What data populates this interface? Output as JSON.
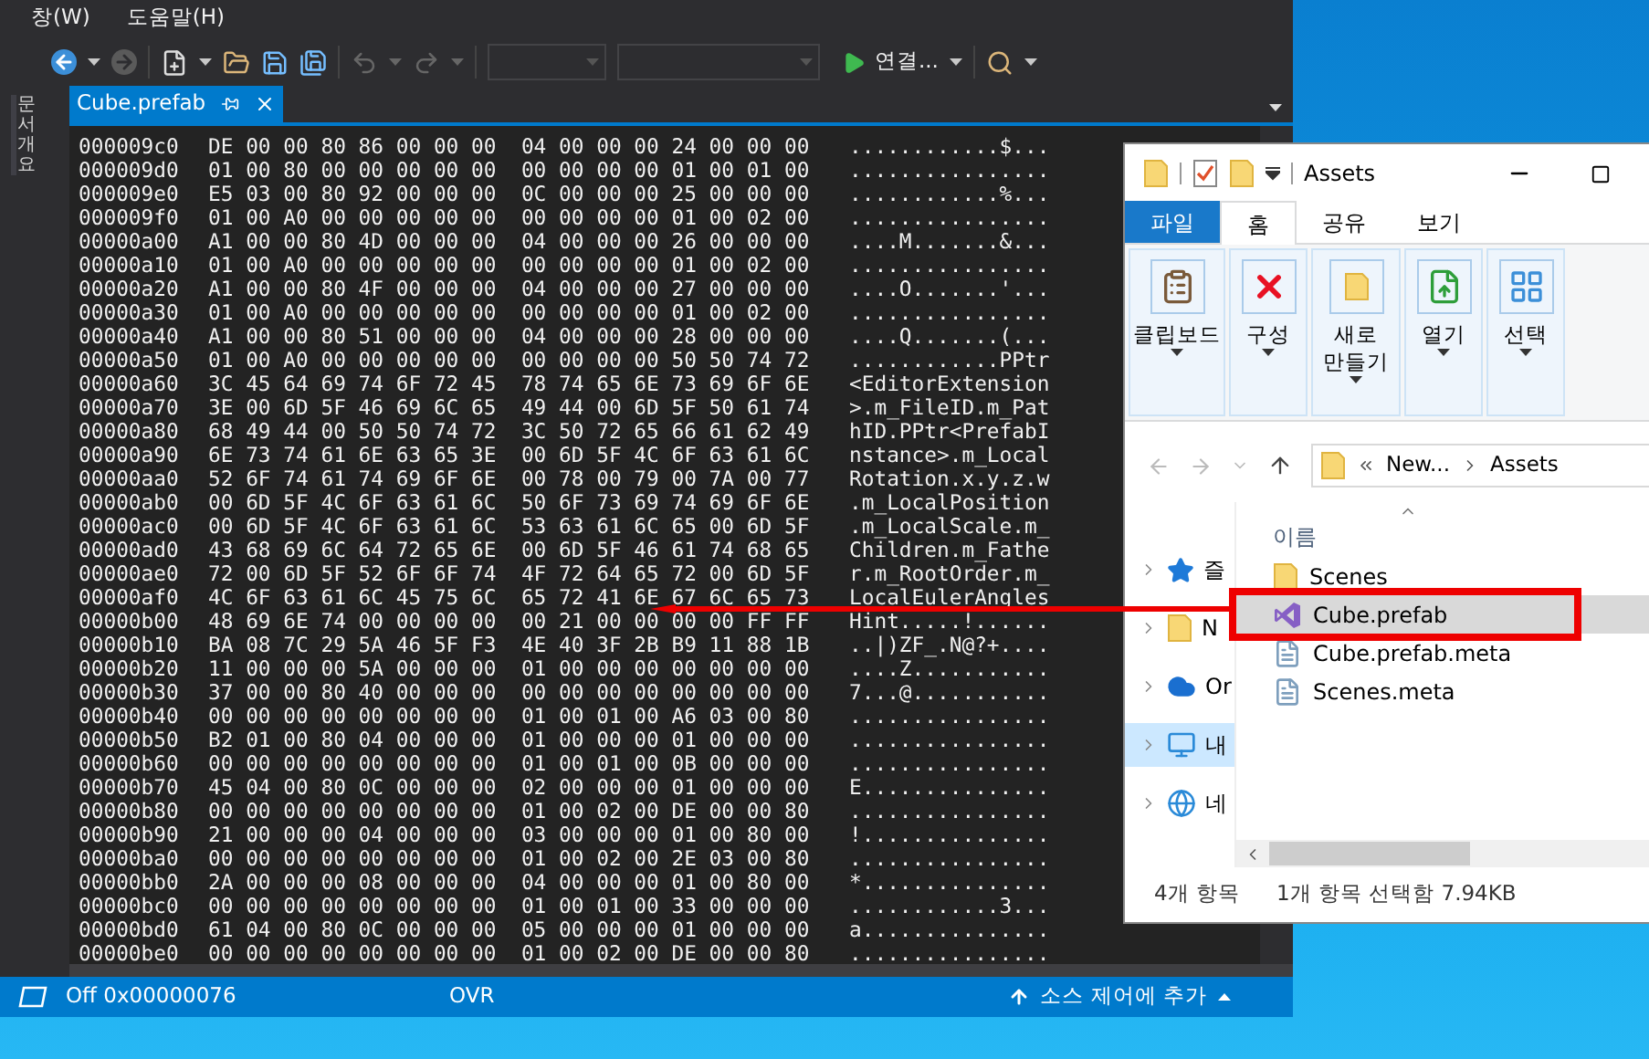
{
  "ide": {
    "menu": [
      {
        "label": "창(W)"
      },
      {
        "label": "도움말(H)"
      }
    ],
    "toolbar": {
      "run_label": "연결..."
    },
    "side_tab": "문서 개요",
    "tabs": [
      {
        "label": "Cube.prefab",
        "selected": true
      }
    ],
    "hex_rows": [
      {
        "offset": "000009c0",
        "bytes": "DE 00 00 80 86 00 00 00  04 00 00 00 24 00 00 00",
        "text": "............$..."
      },
      {
        "offset": "000009d0",
        "bytes": "01 00 80 00 00 00 00 00  00 00 00 00 01 00 01 00",
        "text": "................"
      },
      {
        "offset": "000009e0",
        "bytes": "E5 03 00 80 92 00 00 00  0C 00 00 00 25 00 00 00",
        "text": "............%..."
      },
      {
        "offset": "000009f0",
        "bytes": "01 00 A0 00 00 00 00 00  00 00 00 00 01 00 02 00",
        "text": "................"
      },
      {
        "offset": "00000a00",
        "bytes": "A1 00 00 80 4D 00 00 00  04 00 00 00 26 00 00 00",
        "text": "....M.......&..."
      },
      {
        "offset": "00000a10",
        "bytes": "01 00 A0 00 00 00 00 00  00 00 00 00 01 00 02 00",
        "text": "................"
      },
      {
        "offset": "00000a20",
        "bytes": "A1 00 00 80 4F 00 00 00  04 00 00 00 27 00 00 00",
        "text": "....O.......'..."
      },
      {
        "offset": "00000a30",
        "bytes": "01 00 A0 00 00 00 00 00  00 00 00 00 01 00 02 00",
        "text": "................"
      },
      {
        "offset": "00000a40",
        "bytes": "A1 00 00 80 51 00 00 00  04 00 00 00 28 00 00 00",
        "text": "....Q.......(..."
      },
      {
        "offset": "00000a50",
        "bytes": "01 00 A0 00 00 00 00 00  00 00 00 00 50 50 74 72",
        "text": "............PPtr"
      },
      {
        "offset": "00000a60",
        "bytes": "3C 45 64 69 74 6F 72 45  78 74 65 6E 73 69 6F 6E",
        "text": "<EditorExtension"
      },
      {
        "offset": "00000a70",
        "bytes": "3E 00 6D 5F 46 69 6C 65  49 44 00 6D 5F 50 61 74",
        "text": ">.m_FileID.m_Pat"
      },
      {
        "offset": "00000a80",
        "bytes": "68 49 44 00 50 50 74 72  3C 50 72 65 66 61 62 49",
        "text": "hID.PPtr<PrefabI"
      },
      {
        "offset": "00000a90",
        "bytes": "6E 73 74 61 6E 63 65 3E  00 6D 5F 4C 6F 63 61 6C",
        "text": "nstance>.m_Local"
      },
      {
        "offset": "00000aa0",
        "bytes": "52 6F 74 61 74 69 6F 6E  00 78 00 79 00 7A 00 77",
        "text": "Rotation.x.y.z.w"
      },
      {
        "offset": "00000ab0",
        "bytes": "00 6D 5F 4C 6F 63 61 6C  50 6F 73 69 74 69 6F 6E",
        "text": ".m_LocalPosition"
      },
      {
        "offset": "00000ac0",
        "bytes": "00 6D 5F 4C 6F 63 61 6C  53 63 61 6C 65 00 6D 5F",
        "text": ".m_LocalScale.m_"
      },
      {
        "offset": "00000ad0",
        "bytes": "43 68 69 6C 64 72 65 6E  00 6D 5F 46 61 74 68 65",
        "text": "Children.m_Fathe"
      },
      {
        "offset": "00000ae0",
        "bytes": "72 00 6D 5F 52 6F 6F 74  4F 72 64 65 72 00 6D 5F",
        "text": "r.m_RootOrder.m_"
      },
      {
        "offset": "00000af0",
        "bytes": "4C 6F 63 61 6C 45 75 6C  65 72 41 6E 67 6C 65 73",
        "text": "LocalEulerAngles"
      },
      {
        "offset": "00000b00",
        "bytes": "48 69 6E 74 00 00 00 00  00 21 00 00 00 00 FF FF",
        "text": "Hint.....!......"
      },
      {
        "offset": "00000b10",
        "bytes": "BA 08 7C 29 5A 46 5F F3  4E 40 3F 2B B9 11 88 1B",
        "text": "..|)ZF_.N@?+...."
      },
      {
        "offset": "00000b20",
        "bytes": "11 00 00 00 5A 00 00 00  01 00 00 00 00 00 00 00",
        "text": "....Z..........."
      },
      {
        "offset": "00000b30",
        "bytes": "37 00 00 80 40 00 00 00  00 00 00 00 00 00 00 00",
        "text": "7...@..........."
      },
      {
        "offset": "00000b40",
        "bytes": "00 00 00 00 00 00 00 00  01 00 01 00 A6 03 00 80",
        "text": "................"
      },
      {
        "offset": "00000b50",
        "bytes": "B2 01 00 80 04 00 00 00  01 00 00 00 01 00 00 00",
        "text": "................"
      },
      {
        "offset": "00000b60",
        "bytes": "00 00 00 00 00 00 00 00  01 00 01 00 0B 00 00 00",
        "text": "................"
      },
      {
        "offset": "00000b70",
        "bytes": "45 04 00 80 0C 00 00 00  02 00 00 00 01 00 00 00",
        "text": "E..............."
      },
      {
        "offset": "00000b80",
        "bytes": "00 00 00 00 00 00 00 00  01 00 02 00 DE 00 00 80",
        "text": "................"
      },
      {
        "offset": "00000b90",
        "bytes": "21 00 00 00 04 00 00 00  03 00 00 00 01 00 80 00",
        "text": "!..............."
      },
      {
        "offset": "00000ba0",
        "bytes": "00 00 00 00 00 00 00 00  01 00 02 00 2E 03 00 80",
        "text": "................"
      },
      {
        "offset": "00000bb0",
        "bytes": "2A 00 00 00 08 00 00 00  04 00 00 00 01 00 80 00",
        "text": "*..............."
      },
      {
        "offset": "00000bc0",
        "bytes": "00 00 00 00 00 00 00 00  01 00 01 00 33 00 00 00",
        "text": "............3..."
      },
      {
        "offset": "00000bd0",
        "bytes": "61 04 00 80 0C 00 00 00  05 00 00 00 01 00 00 00",
        "text": "a..............."
      },
      {
        "offset": "00000be0",
        "bytes": "00 00 00 00 00 00 00 00  01 00 02 00 DE 00 00 80",
        "text": "................"
      }
    ],
    "status_bar": {
      "position": "Off 0x00000076",
      "mode": "OVR",
      "source_control": "소스 제어에 추가"
    }
  },
  "explorer": {
    "title": "Assets",
    "ribbon_tabs": [
      {
        "label": "파일",
        "kind": "file",
        "selected": false
      },
      {
        "label": "홈",
        "kind": "tab",
        "selected": true
      },
      {
        "label": "공유",
        "kind": "tab",
        "selected": false
      },
      {
        "label": "보기",
        "kind": "tab",
        "selected": false
      }
    ],
    "ribbon_groups": [
      {
        "label": "클립보드",
        "kind": "clipboard"
      },
      {
        "label": "구성",
        "kind": "organize"
      },
      {
        "label": "새로 만들기",
        "kind": "new"
      },
      {
        "label": "열기",
        "kind": "open"
      },
      {
        "label": "선택",
        "kind": "select"
      }
    ],
    "address": [
      "New...",
      "Assets"
    ],
    "nav_items": [
      {
        "label": "즐",
        "kind": "star",
        "selected": false
      },
      {
        "label": "N",
        "kind": "folder",
        "selected": false
      },
      {
        "label": "Or",
        "kind": "cloud",
        "selected": false
      },
      {
        "label": "내",
        "kind": "pc",
        "selected": true
      },
      {
        "label": "네",
        "kind": "network",
        "selected": false
      }
    ],
    "column_header": "이름",
    "files": [
      {
        "name": "Scenes",
        "kind": "folder",
        "selected": false
      },
      {
        "name": "Cube.prefab",
        "kind": "vs",
        "selected": true
      },
      {
        "name": "Cube.prefab.meta",
        "kind": "text",
        "selected": false
      },
      {
        "name": "Scenes.meta",
        "kind": "text",
        "selected": false
      }
    ],
    "status": [
      "4개 항목",
      "1개 항목 선택함 7.94KB"
    ]
  }
}
